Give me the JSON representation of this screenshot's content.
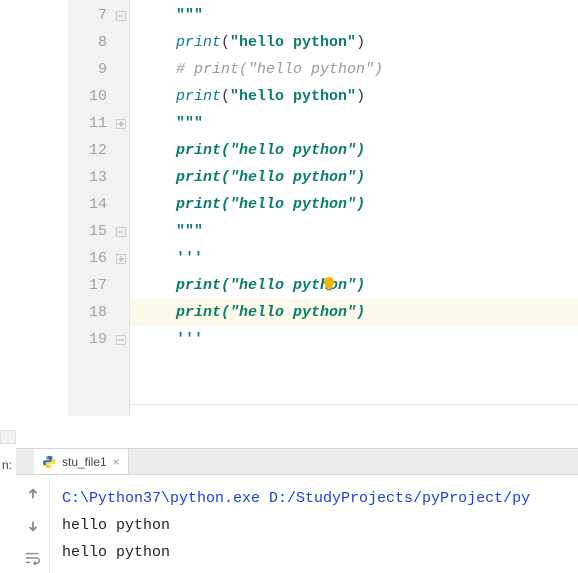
{
  "editor": {
    "lines": [
      {
        "num": 7,
        "type": "triple",
        "indent": 1,
        "fold": "close",
        "text": "\"\"\""
      },
      {
        "num": 8,
        "type": "call",
        "indent": 1,
        "func": "print",
        "lp": "(",
        "str": "\"hello python\"",
        "rp": ")"
      },
      {
        "num": 9,
        "type": "comment",
        "indent": 1,
        "text": "# print(\"hello python\")"
      },
      {
        "num": 10,
        "type": "call",
        "indent": 1,
        "func": "print",
        "lp": "(",
        "str": "\"hello python\"",
        "rp": ")"
      },
      {
        "num": 11,
        "type": "triple",
        "indent": 1,
        "fold": "open",
        "text": "\"\"\""
      },
      {
        "num": 12,
        "type": "doc",
        "indent": 1,
        "func": "print",
        "lp": "(",
        "str": "\"hello python\"",
        "rp": ")"
      },
      {
        "num": 13,
        "type": "doc",
        "indent": 1,
        "func": "print",
        "lp": "(",
        "str": "\"hello python\"",
        "rp": ")"
      },
      {
        "num": 14,
        "type": "doc",
        "indent": 1,
        "func": "print",
        "lp": "(",
        "str": "\"hello python\"",
        "rp": ")"
      },
      {
        "num": 15,
        "type": "triple",
        "indent": 1,
        "fold": "close",
        "text": "\"\"\""
      },
      {
        "num": 16,
        "type": "triple",
        "indent": 1,
        "fold": "open",
        "text": "'''"
      },
      {
        "num": 17,
        "type": "doc",
        "indent": 1,
        "func": "print",
        "lp": "(",
        "str": "\"hello python\"",
        "rp": ")",
        "bulb": true
      },
      {
        "num": 18,
        "type": "doc",
        "indent": 1,
        "func": "print",
        "lp": "(",
        "str": "\"hello python\"",
        "rp": ")",
        "highlight": true
      },
      {
        "num": 19,
        "type": "triple",
        "indent": 1,
        "fold": "close",
        "text": "'''"
      },
      {
        "num": "",
        "type": "blank"
      },
      {
        "num": "",
        "type": "blank"
      }
    ]
  },
  "run": {
    "label_prefix": "n:",
    "tab": {
      "name": "stu_file1"
    },
    "cmd": "C:\\Python37\\python.exe D:/StudyProjects/pyProject/py",
    "output": [
      "hello python",
      "hello python"
    ]
  }
}
